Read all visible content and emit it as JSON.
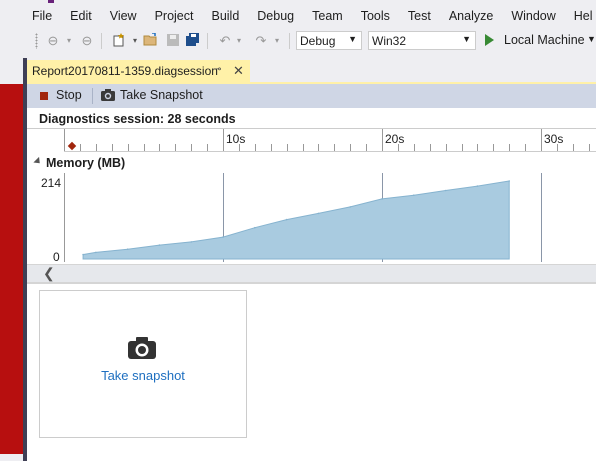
{
  "menu": [
    "File",
    "Edit",
    "View",
    "Project",
    "Build",
    "Debug",
    "Team",
    "Tools",
    "Test",
    "Analyze",
    "Window",
    "Hel"
  ],
  "toolbar": {
    "config_value": "Debug",
    "platform_value": "Win32",
    "run_label": "Local Machine"
  },
  "tab": {
    "title": "Report20170811-1359.diagsession",
    "pin_glyph": "⊸",
    "close_glyph": "✕"
  },
  "session_toolbar": {
    "stop_label": "Stop",
    "snapshot_label": "Take Snapshot"
  },
  "status": {
    "text": "Diagnostics session: 28 seconds"
  },
  "ruler": {
    "labels": [
      "10s",
      "20s",
      "30s"
    ]
  },
  "memory": {
    "title": "Memory (MB)",
    "y_max_label": "214",
    "y_min_label": "0"
  },
  "snapshot_card": {
    "link": "Take snapshot"
  },
  "colors": {
    "tab_active": "#fff1a8",
    "session_toolbar_bg": "#cfd6e5",
    "stop_red": "#a1260d",
    "area_fill": "#a9cbe0",
    "link_blue": "#1e6fc0"
  },
  "chart_data": {
    "type": "area",
    "ylabel": "Memory (MB)",
    "ylim": [
      0,
      214
    ],
    "xlim": [
      0,
      30
    ],
    "x": [
      1.2,
      2,
      4,
      6,
      8,
      10,
      12,
      14,
      16,
      18,
      20,
      22,
      24,
      26,
      28
    ],
    "values": [
      12,
      18,
      27,
      38,
      47,
      60,
      86,
      108,
      125,
      143,
      165,
      175,
      188,
      200,
      214
    ]
  }
}
